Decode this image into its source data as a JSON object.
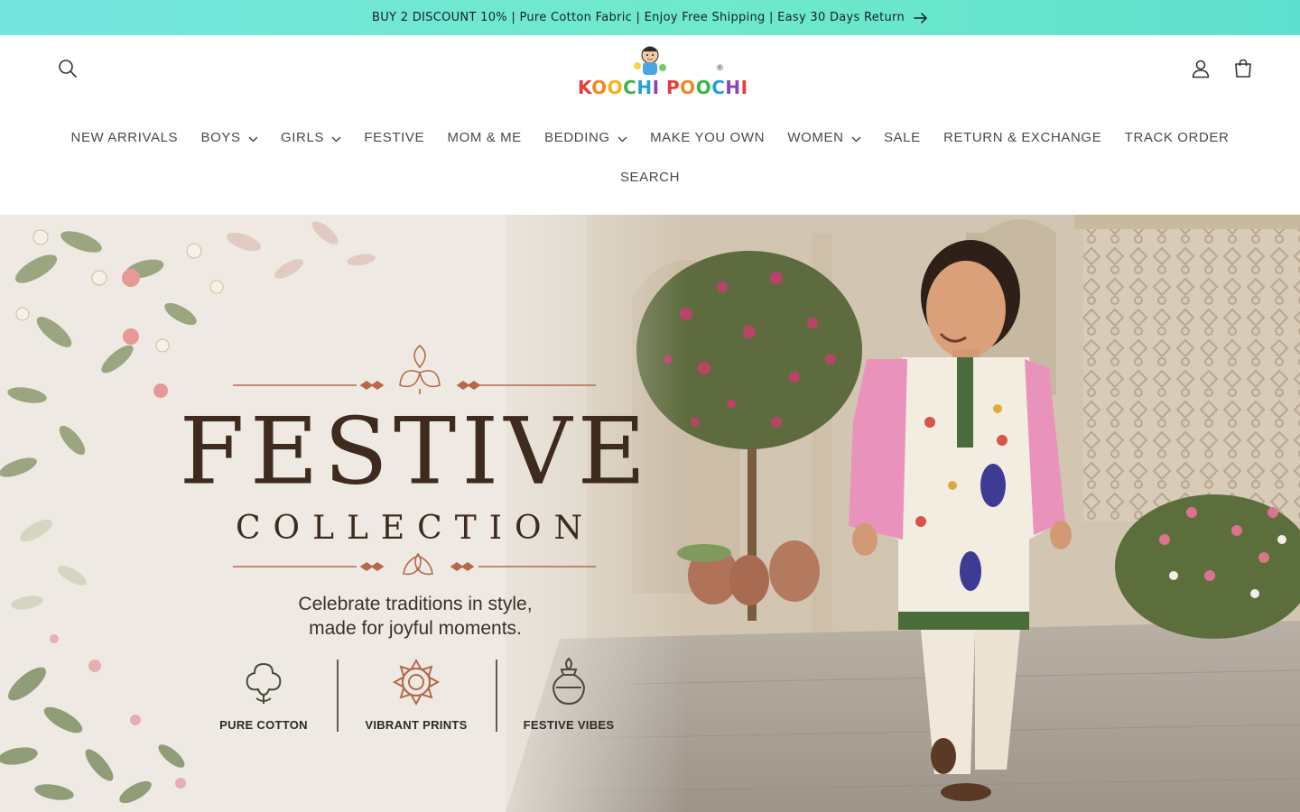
{
  "announcement": {
    "text": "BUY 2 DISCOUNT 10% | Pure Cotton Fabric | Enjoy Free Shipping | Easy 30 Days Return",
    "arrow_icon": "arrow-right-icon"
  },
  "header": {
    "logo": {
      "text_parts": [
        "K",
        "O",
        "O",
        "C",
        "H",
        "I",
        " ",
        "P",
        "O",
        "O",
        "C",
        "H",
        "I"
      ],
      "registered": "®"
    },
    "icons": {
      "search": "search-icon",
      "account": "user-icon",
      "cart": "cart-icon"
    }
  },
  "nav": {
    "row1": [
      {
        "label": "NEW ARRIVALS",
        "dropdown": false
      },
      {
        "label": "BOYS",
        "dropdown": true
      },
      {
        "label": "GIRLS",
        "dropdown": true
      },
      {
        "label": "FESTIVE",
        "dropdown": false
      },
      {
        "label": "MOM & ME",
        "dropdown": false
      },
      {
        "label": "BEDDING",
        "dropdown": true
      },
      {
        "label": "MAKE YOU OWN",
        "dropdown": false
      },
      {
        "label": "WOMEN",
        "dropdown": true
      },
      {
        "label": "SALE",
        "dropdown": false
      },
      {
        "label": "RETURN & EXCHANGE",
        "dropdown": false
      },
      {
        "label": "TRACK ORDER",
        "dropdown": false
      }
    ],
    "row2": [
      {
        "label": "SEARCH",
        "dropdown": false
      }
    ]
  },
  "hero": {
    "title": "FESTIVE",
    "subtitle": "COLLECTION",
    "tagline_line1": "Celebrate traditions in style,",
    "tagline_line2": "made for joyful moments.",
    "features": [
      {
        "label": "PURE COTTON",
        "icon": "cotton-flower-icon"
      },
      {
        "label": "VIBRANT PRINTS",
        "icon": "mandala-icon"
      },
      {
        "label": "FESTIVE VIBES",
        "icon": "kalash-icon"
      }
    ]
  },
  "colors": {
    "announcement_bg": "#74e4df",
    "nav_text": "#4a4a4a",
    "hero_title": "#3e2a1e",
    "hero_ornament": "#b5694a"
  }
}
